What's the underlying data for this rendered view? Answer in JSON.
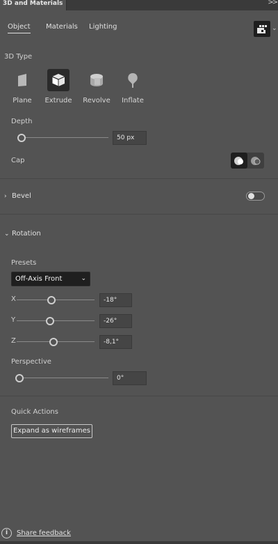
{
  "panel": {
    "title": "3D and Materials",
    "collapse_glyph": ">>"
  },
  "tabs": [
    {
      "label": "Object",
      "active": true
    },
    {
      "label": "Materials",
      "active": false
    },
    {
      "label": "Lighting",
      "active": false
    }
  ],
  "viewer": {
    "icon": "render-preview-icon",
    "caret": "⌄"
  },
  "type_section": {
    "title": "3D Type",
    "tools": [
      {
        "label": "Plane",
        "icon": "plane-icon",
        "active": false
      },
      {
        "label": "Extrude",
        "icon": "extrude-icon",
        "active": true
      },
      {
        "label": "Revolve",
        "icon": "revolve-icon",
        "active": false
      },
      {
        "label": "Inflate",
        "icon": "inflate-icon",
        "active": false
      }
    ]
  },
  "depth": {
    "label": "Depth",
    "value": "50 px",
    "slider_fraction": 0.0
  },
  "cap": {
    "label": "Cap",
    "options": [
      "cap-on-icon",
      "cap-off-icon"
    ],
    "selected": 0
  },
  "bevel": {
    "label": "Bevel",
    "enabled": false
  },
  "rotation": {
    "label": "Rotation",
    "presets_label": "Presets",
    "preset_value": "Off-Axis Front",
    "axes": [
      {
        "label": "X",
        "value": "-18°",
        "fraction": 0.45
      },
      {
        "label": "Y",
        "value": "-26°",
        "fraction": 0.43
      },
      {
        "label": "Z",
        "value": "-8,1°",
        "fraction": 0.48
      }
    ],
    "perspective_label": "Perspective",
    "perspective_value": "0°",
    "perspective_fraction": 0.0
  },
  "quick_actions": {
    "label": "Quick Actions",
    "button": "Expand as wireframes"
  },
  "footer": {
    "feedback": "Share feedback",
    "info_glyph": "i"
  },
  "colors": {
    "panel_bg": "#535353",
    "dark_bg": "#3a3a3a",
    "field_bg": "#454545",
    "active_bg": "#2a2a2a"
  }
}
